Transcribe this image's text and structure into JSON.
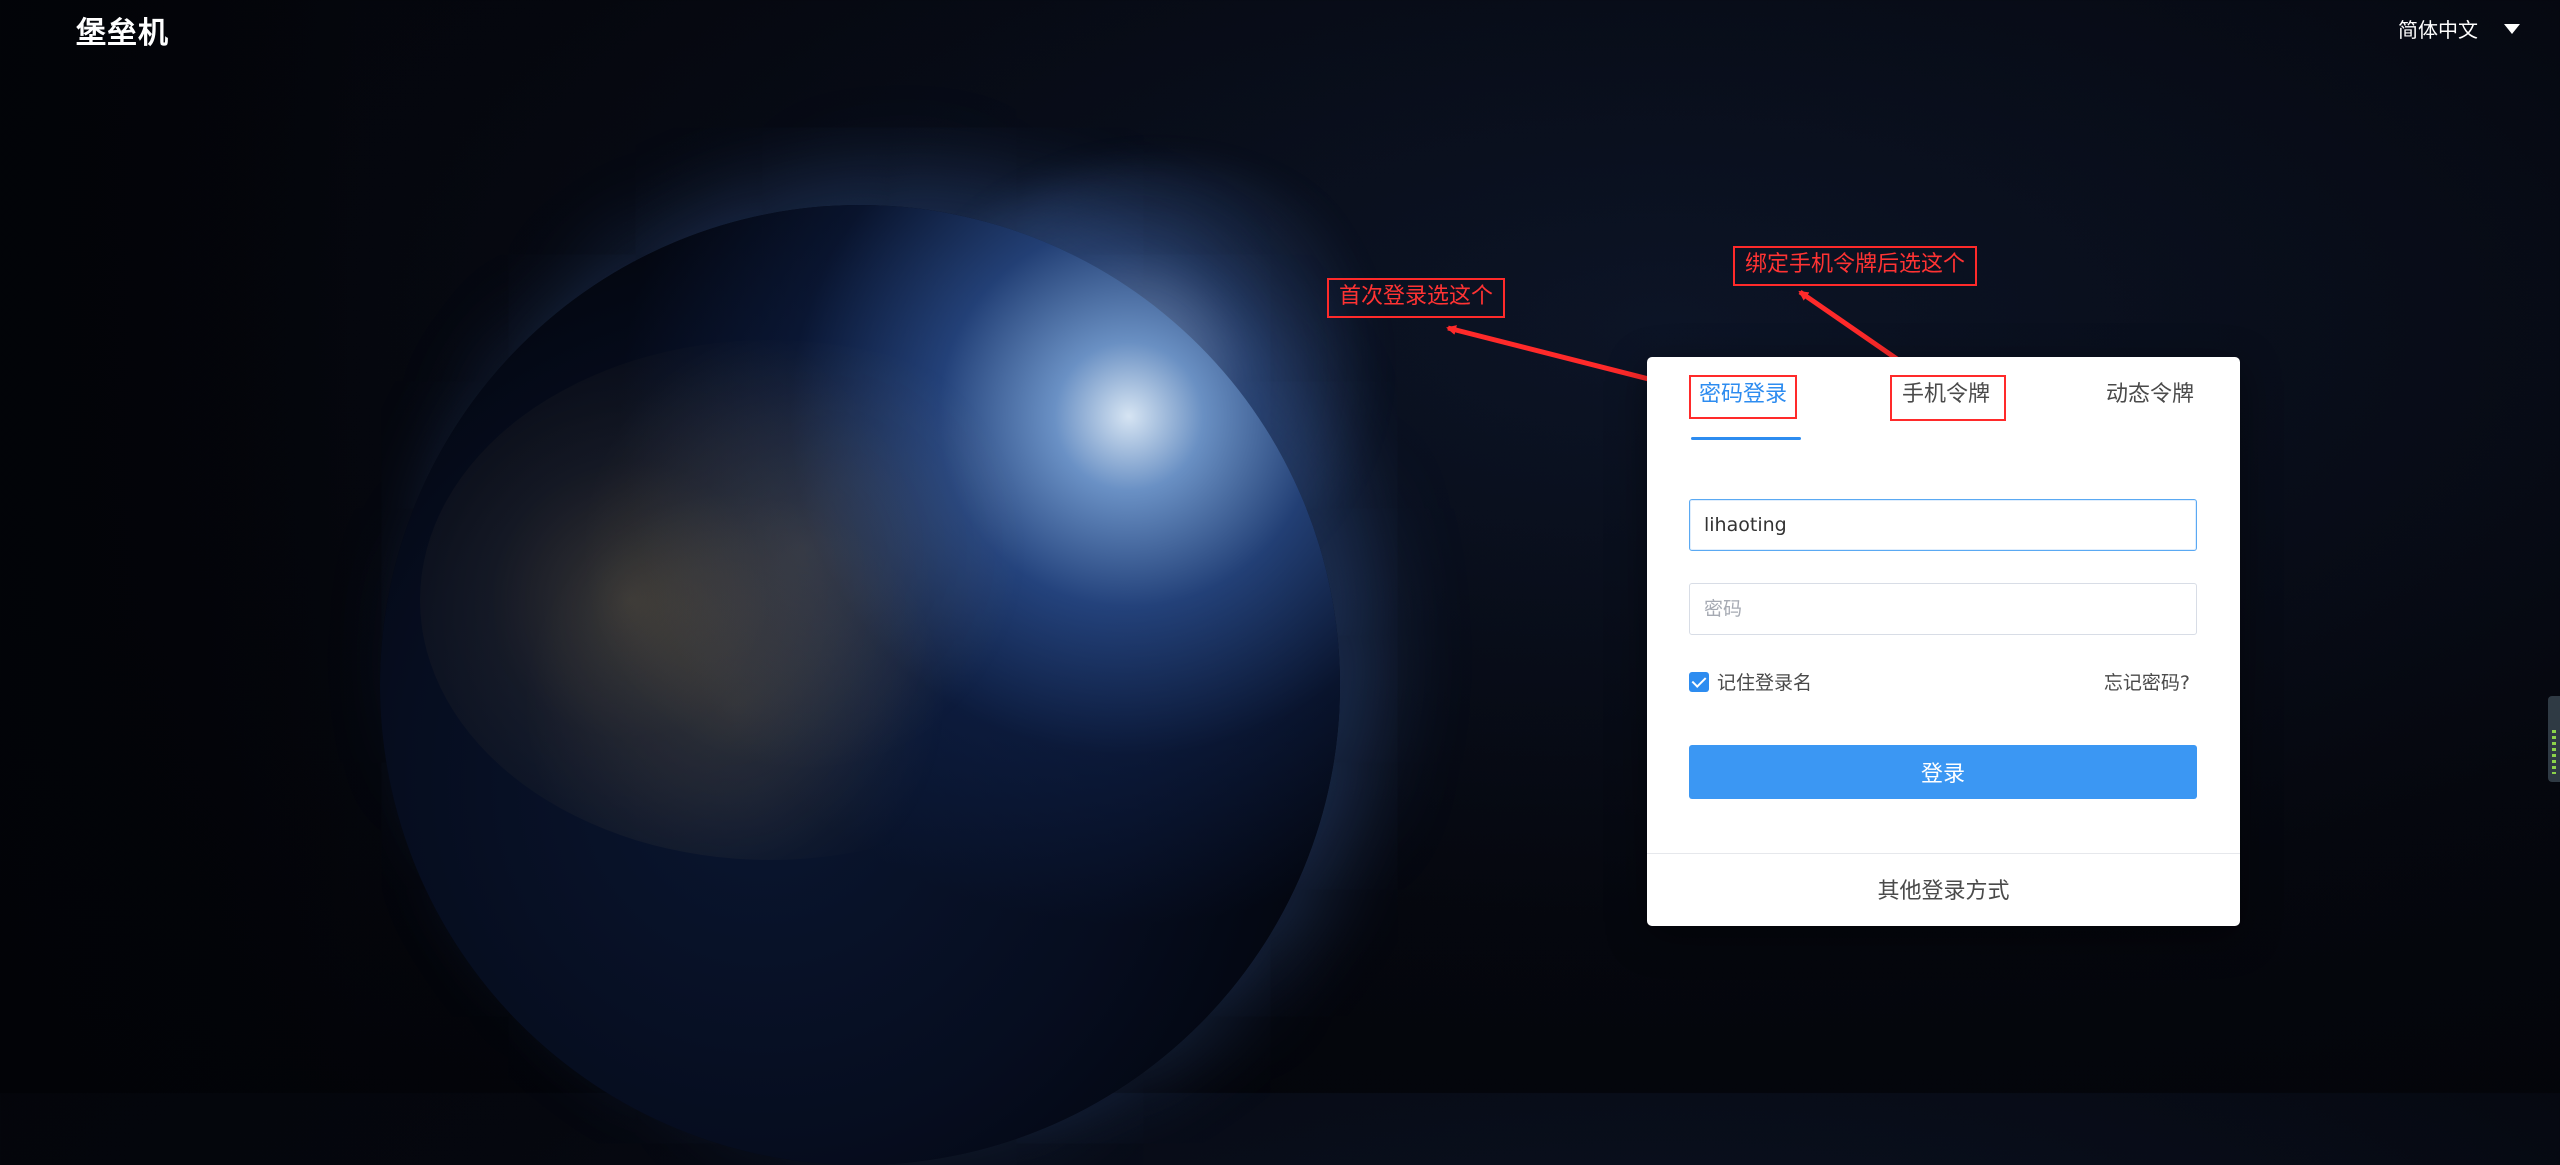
{
  "header": {
    "logo_text": "堡垒机",
    "language": "简体中文"
  },
  "annotations": {
    "note_first_login": "首次登录选这个",
    "note_after_bind": "绑定手机令牌后选这个"
  },
  "login_card": {
    "tabs": [
      {
        "label": "密码登录",
        "active": true
      },
      {
        "label": "手机令牌",
        "active": false
      },
      {
        "label": "动态令牌",
        "active": false
      }
    ],
    "username_value": "lihaoting",
    "password_placeholder": "密码",
    "remember_label": "记住登录名",
    "remember_checked": true,
    "forgot_label": "忘记密码?",
    "login_button": "登录",
    "other_methods": "其他登录方式"
  },
  "colors": {
    "accent": "#2d8cf0",
    "button": "#3b97f3",
    "annotation_red": "#ff2a2a"
  }
}
